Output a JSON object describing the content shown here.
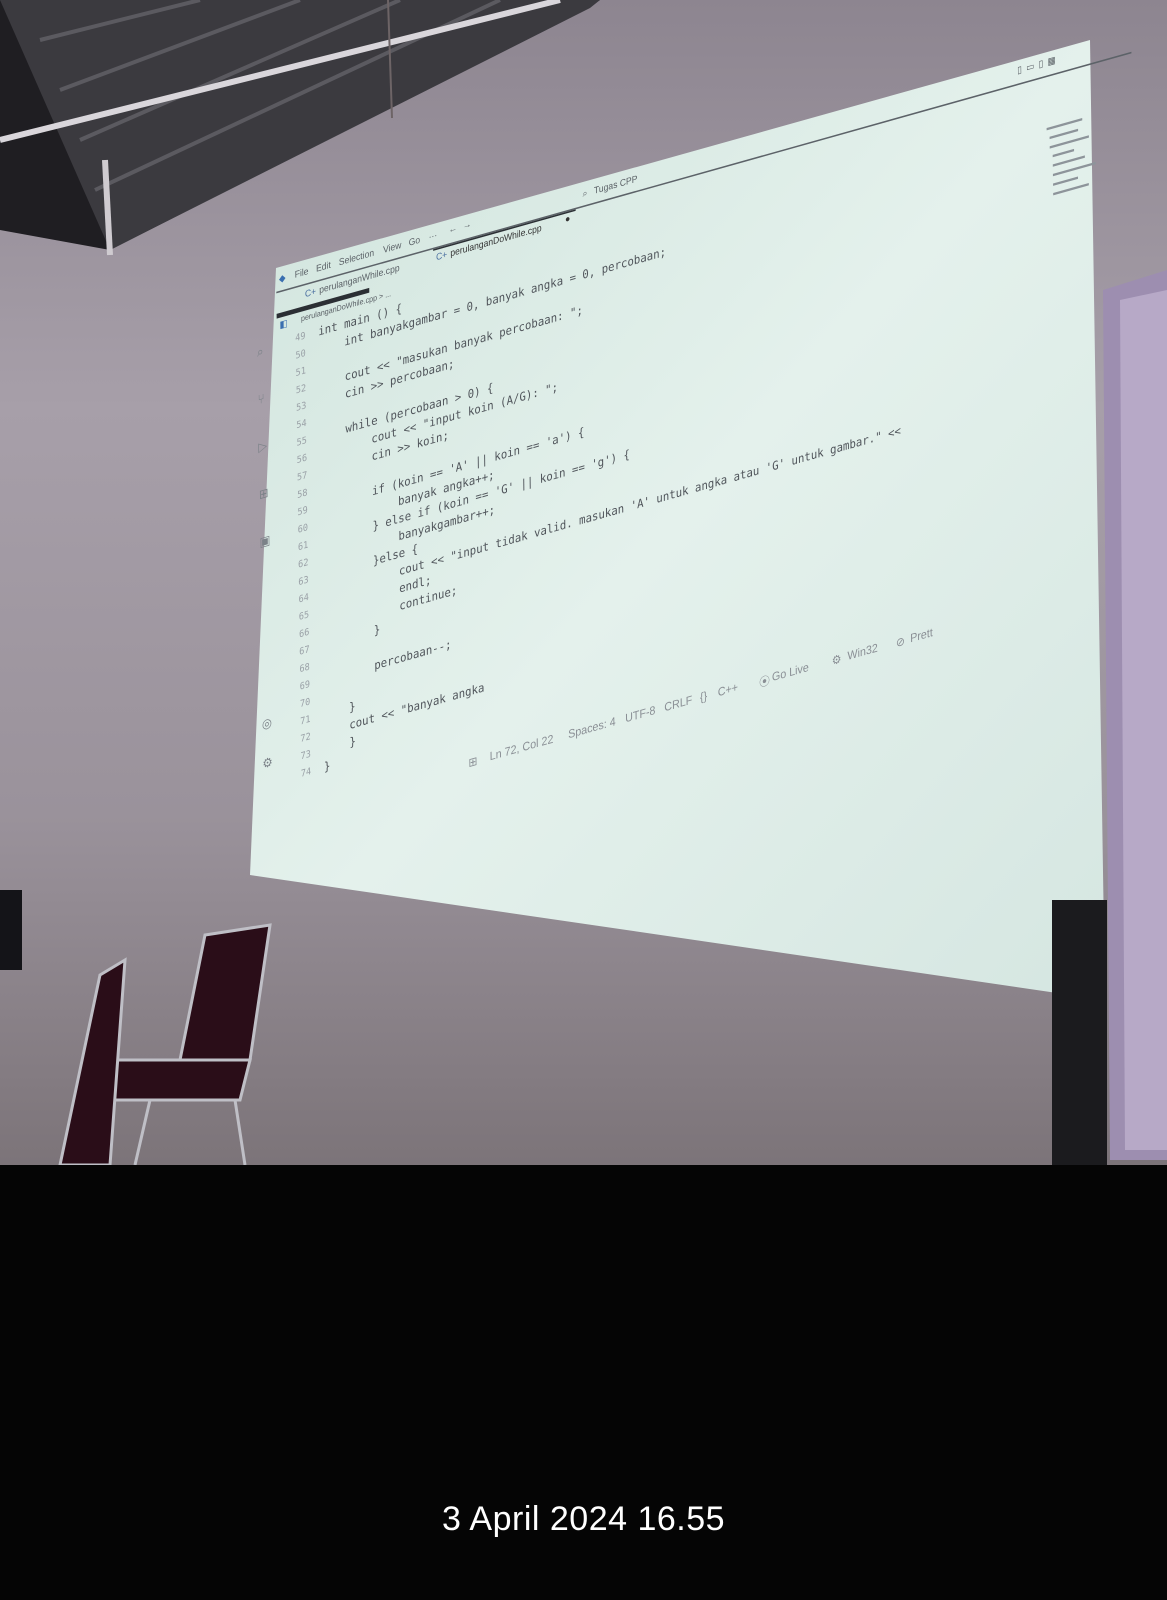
{
  "window": {
    "search_label": "Tugas CPP",
    "menu": [
      "File",
      "Edit",
      "Selection",
      "View",
      "Go",
      "···"
    ],
    "tabs": [
      {
        "label": "perulanganWhile.cpp",
        "active": false
      },
      {
        "label": "perulanganDoWhile.cpp",
        "active": true,
        "modified": true
      }
    ],
    "breadcrumb": "perulanganDoWhile.cpp > ..."
  },
  "editor": {
    "lines": [
      {
        "num": "49",
        "text": "int main () {"
      },
      {
        "num": "50",
        "text": "    int banyakgambar = 0, banyak angka = 0, percobaan;"
      },
      {
        "num": "51",
        "text": ""
      },
      {
        "num": "52",
        "text": "    cout << \"masukan banyak percobaan: \";"
      },
      {
        "num": "53",
        "text": "    cin >> percobaan;"
      },
      {
        "num": "54",
        "text": ""
      },
      {
        "num": "55",
        "text": "    while (percobaan > 0) {"
      },
      {
        "num": "56",
        "text": "        cout << \"input koin (A/G): \";"
      },
      {
        "num": "57",
        "text": "        cin >> koin;"
      },
      {
        "num": "58",
        "text": ""
      },
      {
        "num": "59",
        "text": "        if (koin == 'A' || koin == 'a') {"
      },
      {
        "num": "60",
        "text": "            banyak angka++;"
      },
      {
        "num": "61",
        "text": "        } else if (koin == 'G' || koin == 'g') {"
      },
      {
        "num": "62",
        "text": "            banyakgambar++;"
      },
      {
        "num": "63",
        "text": "        }else {"
      },
      {
        "num": "64",
        "text": "            cout << \"input tidak valid. masukan 'A' untuk angka atau 'G' untuk gambar.\" <<"
      },
      {
        "num": "65",
        "text": "            endl;"
      },
      {
        "num": "66",
        "text": "            continue;"
      },
      {
        "num": "67",
        "text": "        }"
      },
      {
        "num": "68",
        "text": ""
      },
      {
        "num": "69",
        "text": "        percobaan--;"
      },
      {
        "num": "70",
        "text": ""
      },
      {
        "num": "71",
        "text": "    }"
      },
      {
        "num": "72",
        "text": "    cout << \"banyak angka"
      },
      {
        "num": "73",
        "text": "    }"
      },
      {
        "num": "74",
        "text": "}"
      }
    ]
  },
  "statusbar": {
    "position": "Ln 72, Col 22",
    "spaces": "Spaces: 4",
    "encoding": "UTF-8",
    "eol": "CRLF",
    "language": "C++",
    "golive": "Go Live",
    "platform": "Win32",
    "prettier": "Prett"
  },
  "photo_timestamp": "3 April 2024 16.55"
}
